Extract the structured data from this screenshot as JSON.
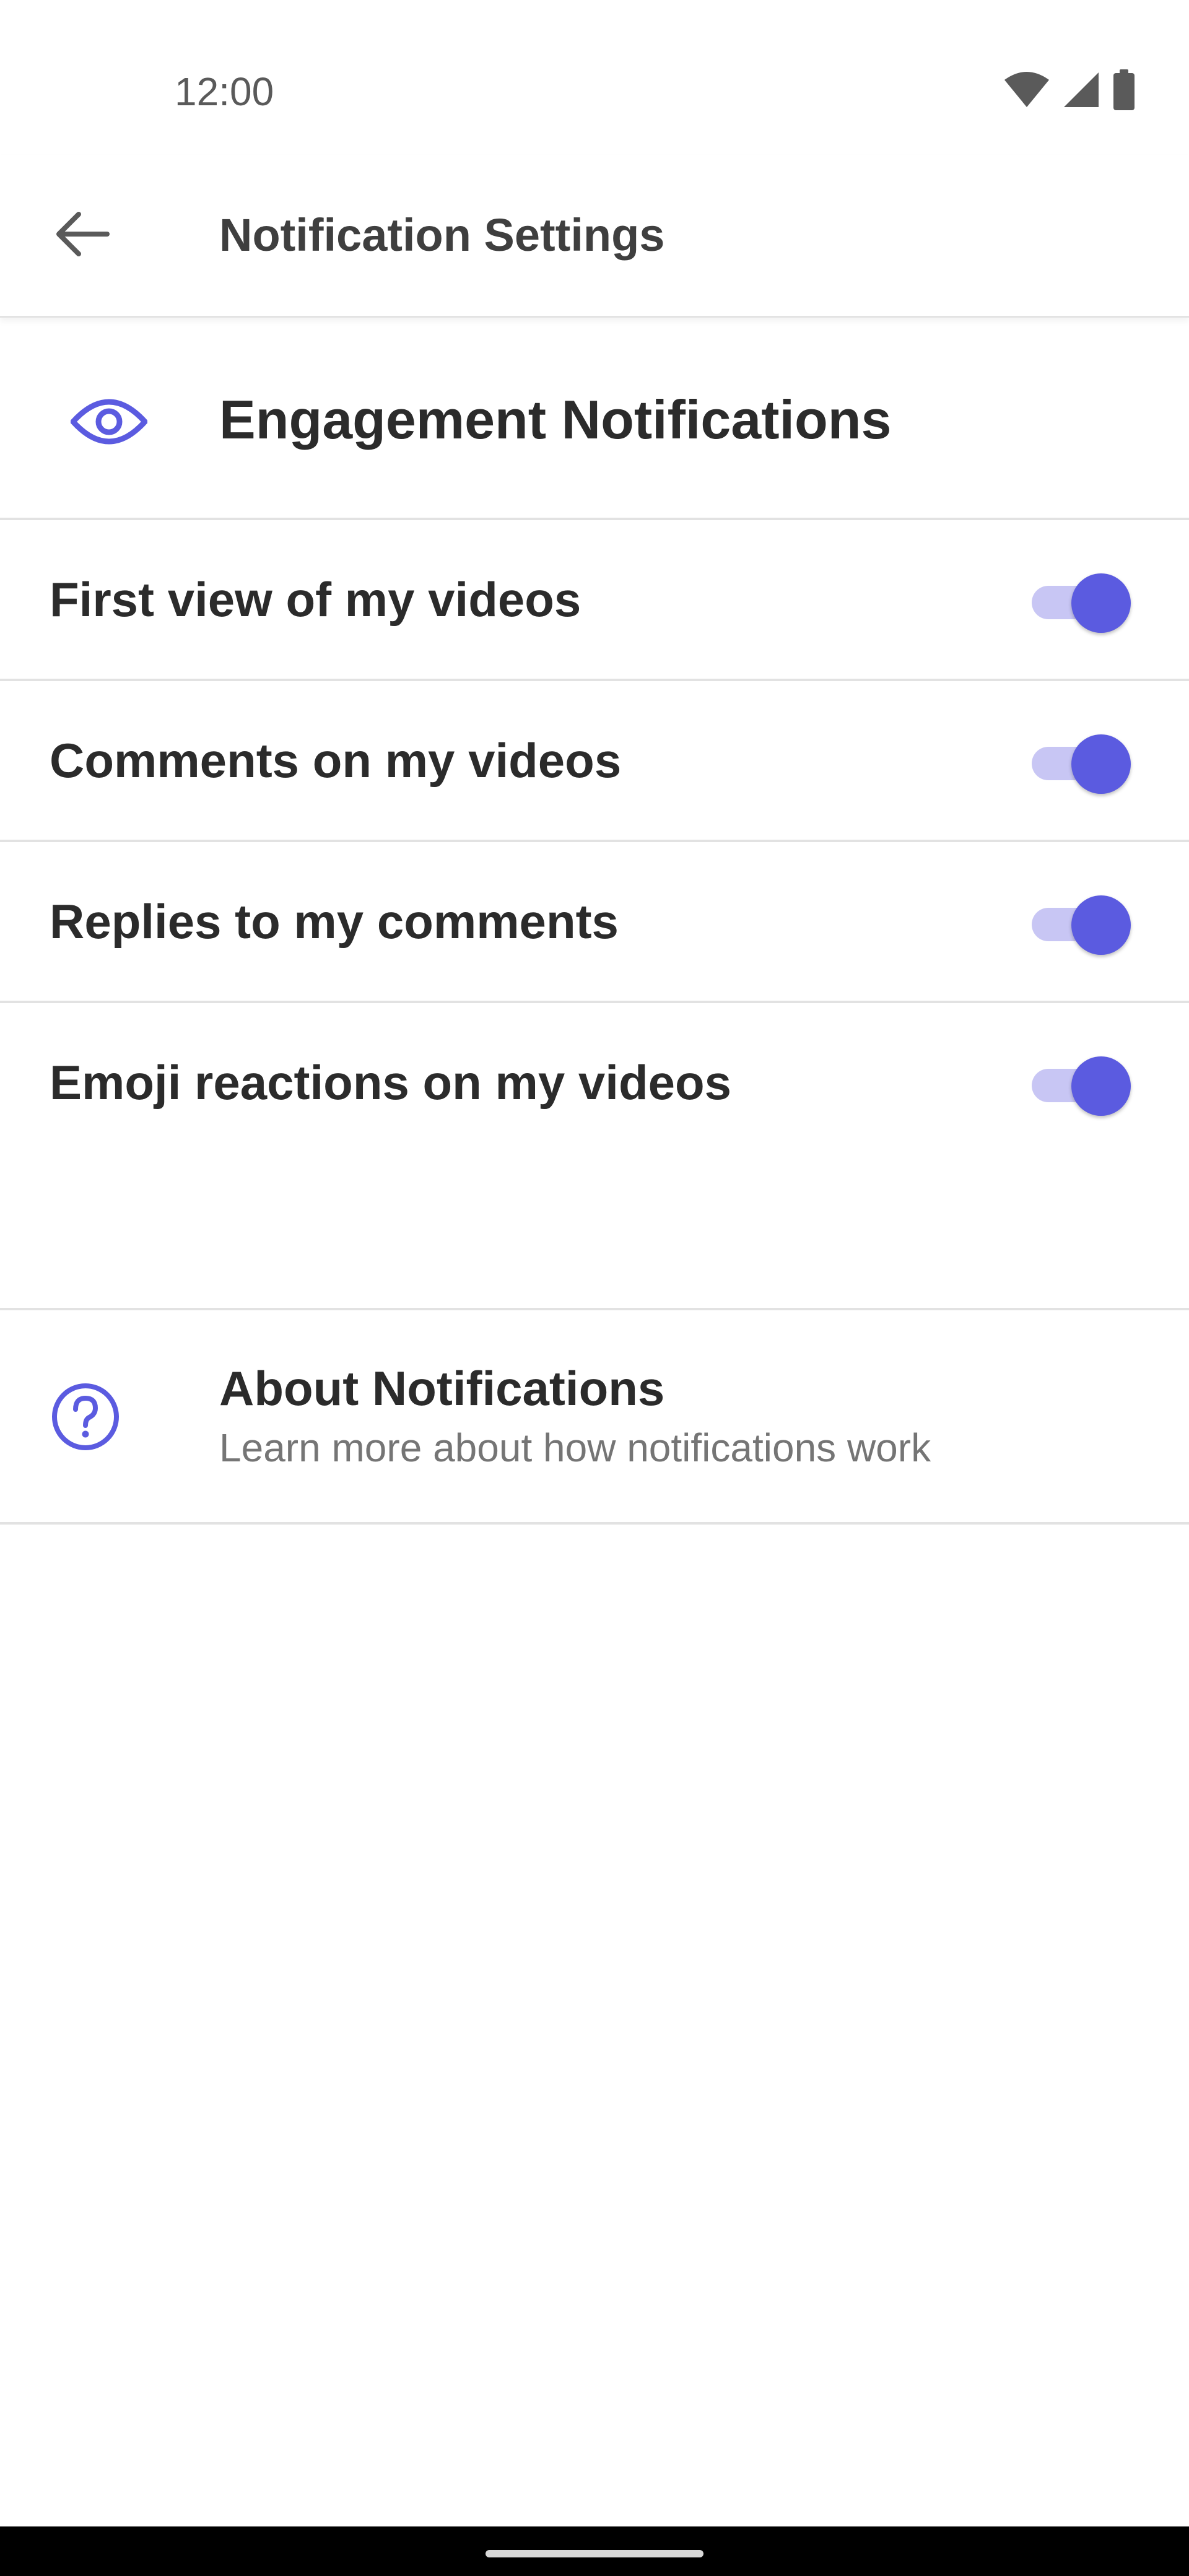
{
  "status_bar": {
    "time": "12:00",
    "icons": [
      "wifi-icon",
      "cellular-signal-icon",
      "battery-icon"
    ]
  },
  "app_bar": {
    "back_icon": "arrow-left-icon",
    "title": "Notification Settings"
  },
  "section": {
    "icon": "eye-icon",
    "title": "Engagement Notifications"
  },
  "toggles": [
    {
      "label": "First view of my videos",
      "checked": true
    },
    {
      "label": "Comments on my videos",
      "checked": true
    },
    {
      "label": "Replies to my comments",
      "checked": true
    },
    {
      "label": "Emoji reactions on my videos",
      "checked": true
    }
  ],
  "about": {
    "icon": "help-circle-icon",
    "title": "About Notifications",
    "subtitle": "Learn more about how notifications work"
  },
  "colors": {
    "accent": "#5b5be0",
    "track": "#c8c6f4",
    "divider": "#e2e2e2",
    "secondary_text": "#757575"
  }
}
